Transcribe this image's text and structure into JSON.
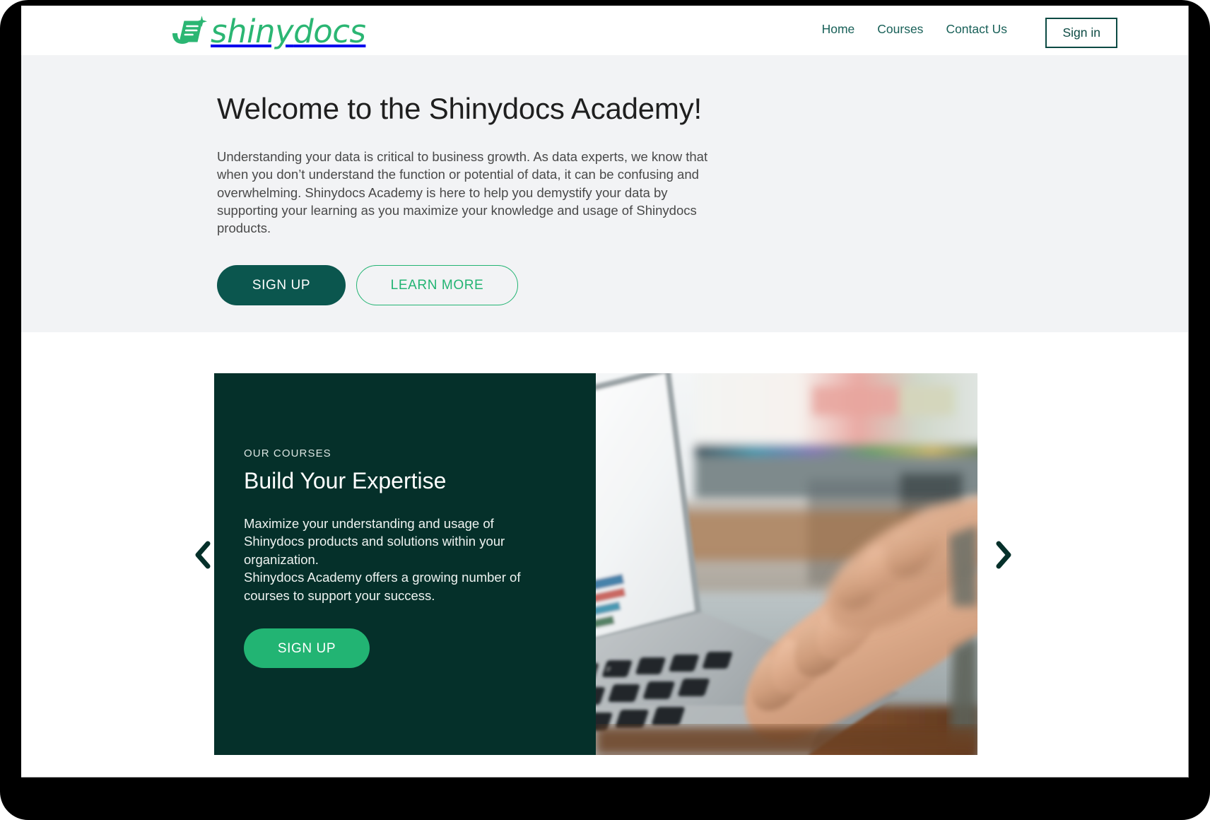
{
  "brand": {
    "wordmark_light": "shiny",
    "wordmark_bold": "docs",
    "mark_icon": "shinydocs-document-swoosh-icon",
    "accent_green": "#2bb673"
  },
  "header": {
    "nav_items": [
      {
        "label": "Home",
        "name": "nav-home"
      },
      {
        "label": "Courses",
        "name": "nav-courses"
      },
      {
        "label": "Contact Us",
        "name": "nav-contact-us"
      }
    ],
    "signin_label": "Sign in"
  },
  "hero": {
    "title": "Welcome to the Shinydocs Academy!",
    "body": "Understanding your data is critical to business growth. As data experts, we know that when you don’t understand the function or potential of data, it can be confusing and overwhelming. Shinydocs Academy is here to help you demystify your data by supporting your learning as you maximize your knowledge and usage of Shinydocs products.",
    "primary_button": "SIGN UP",
    "secondary_button": "LEARN MORE",
    "background_color": "#f2f3f5"
  },
  "carousel": {
    "prev_icon": "chevron-left-icon",
    "next_icon": "chevron-right-icon",
    "card": {
      "eyebrow": "OUR COURSES",
      "title": "Build Your Expertise",
      "body": "Maximize your understanding and usage of Shinydocs products and solutions within your organization.\nShinydocs Academy offers a growing number of courses to support your success.",
      "button_label": "SIGN UP",
      "panel_color": "#05302a",
      "button_color": "#22b473",
      "image_alt": "hands typing on a laptop keyboard at a desk"
    }
  }
}
